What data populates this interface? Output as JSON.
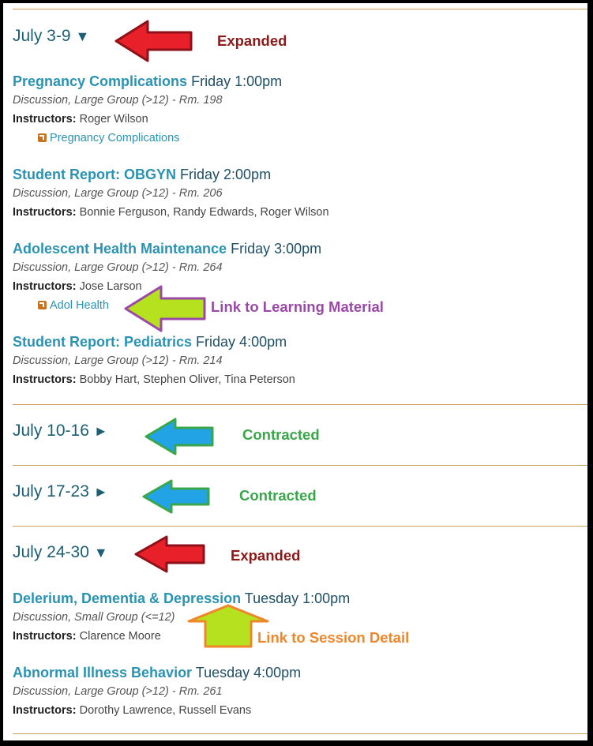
{
  "weeks": [
    {
      "label": "July 3-9",
      "toggle": "▼",
      "state": "expanded"
    },
    {
      "label": "July 10-16",
      "toggle": "►",
      "state": "contracted"
    },
    {
      "label": "July 17-23",
      "toggle": "►",
      "state": "contracted"
    },
    {
      "label": "July 24-30",
      "toggle": "▼",
      "state": "expanded"
    }
  ],
  "sessions": [
    {
      "title": "Pregnancy Complications",
      "time": "Friday 1:00pm",
      "type": "Discussion, Large Group (>12) - Rm. 198",
      "instructors_label": "Instructors:",
      "instructors": "Roger Wilson",
      "material": "Pregnancy Complications"
    },
    {
      "title": "Student Report: OBGYN",
      "time": "Friday 2:00pm",
      "type": "Discussion, Large Group (>12) - Rm. 206",
      "instructors_label": "Instructors:",
      "instructors": "Bonnie Ferguson, Randy Edwards, Roger Wilson"
    },
    {
      "title": "Adolescent Health Maintenance",
      "time": "Friday 3:00pm",
      "type": "Discussion, Large Group (>12) - Rm. 264",
      "instructors_label": "Instructors:",
      "instructors": "Jose Larson",
      "material": "Adol Health"
    },
    {
      "title": "Student Report: Pediatrics",
      "time": "Friday 4:00pm",
      "type": "Discussion, Large Group (>12) - Rm. 214",
      "instructors_label": "Instructors:",
      "instructors": "Bobby Hart, Stephen Oliver, Tina Peterson"
    },
    {
      "title": "Delerium, Dementia & Depression",
      "time": "Tuesday 1:00pm",
      "type": "Discussion, Small Group (<=12)",
      "instructors_label": "Instructors:",
      "instructors": "Clarence Moore"
    },
    {
      "title": "Abnormal Illness Behavior",
      "time": "Tuesday 4:00pm",
      "type": "Discussion, Large Group (>12) - Rm. 261",
      "instructors_label": "Instructors:",
      "instructors": "Dorothy Lawrence, Russell Evans"
    }
  ],
  "annotations": {
    "expanded_1": "Expanded",
    "learning_material": "Link to Learning Material",
    "contracted_1": "Contracted",
    "contracted_2": "Contracted",
    "expanded_2": "Expanded",
    "session_detail": "Link to Session Detail"
  },
  "colors": {
    "expanded": "#8b1a1a",
    "contracted": "#3aa64a",
    "learning_material": "#9b49a8",
    "session_detail": "#f0862a",
    "link": "#2a93b3",
    "heading": "#1c5f75",
    "rule": "#c8a25b"
  }
}
